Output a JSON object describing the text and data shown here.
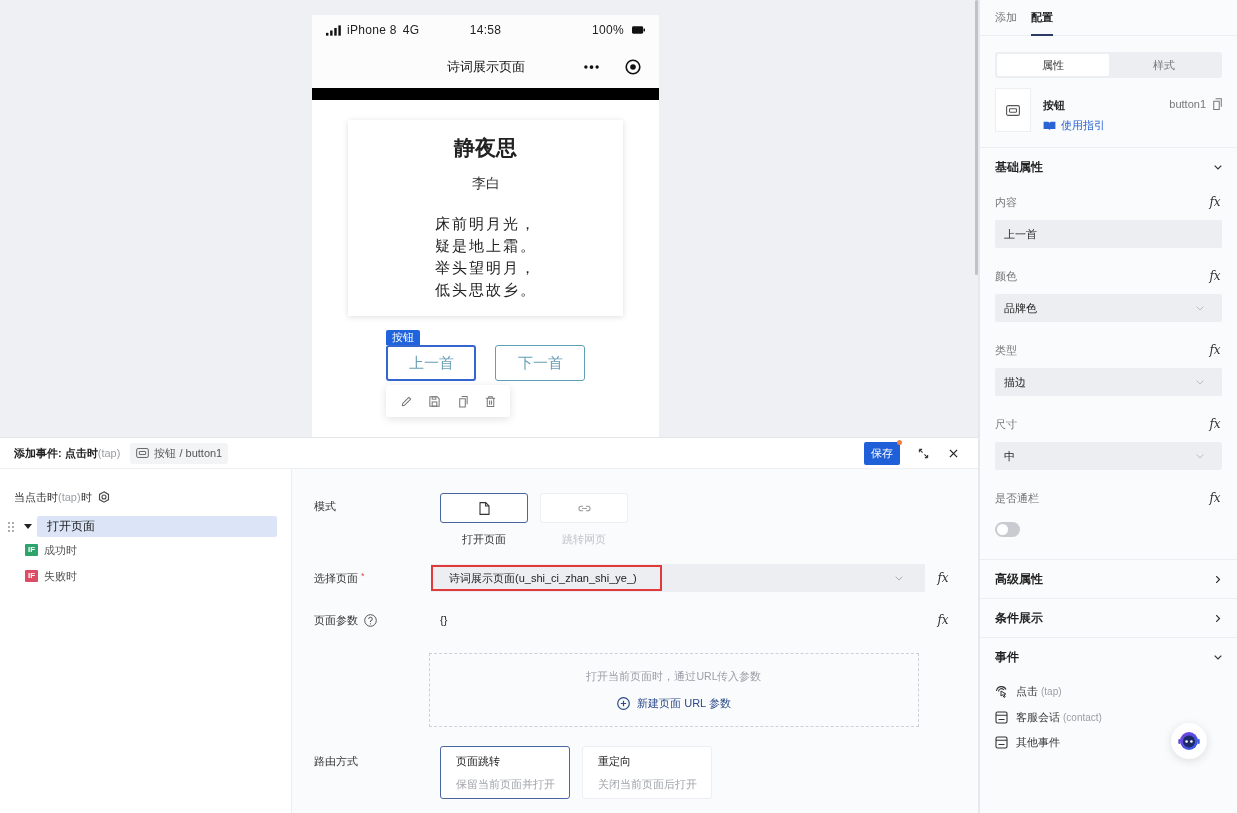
{
  "canvas": {
    "phone": {
      "status_bar": {
        "carrier": "iPhone 8",
        "network": "4G",
        "time": "14:58",
        "battery": "100%"
      },
      "nav_title": "诗词展示页面",
      "poem": {
        "title": "静夜思",
        "author": "李白",
        "lines": [
          "床前明月光，",
          "疑是地上霜。",
          "举头望明月，",
          "低头思故乡。"
        ]
      },
      "selection_tag": "按钮",
      "buttons": [
        {
          "label": "上一首",
          "selected": true
        },
        {
          "label": "下一首",
          "selected": false
        }
      ]
    }
  },
  "event_panel": {
    "title": "添加事件: 点击时",
    "title_hint": "(tap)",
    "target": "按钮 / button1",
    "save": {
      "label": "保存",
      "unsaved": true
    },
    "trigger": {
      "label": "当点击时",
      "hint": "(tap)",
      "suffix": "时"
    },
    "actions": [
      {
        "label": "打开页面",
        "selected": true,
        "expanded": true,
        "children": [
          {
            "badge": "IF",
            "label": "成功时",
            "color": "#2da46c"
          },
          {
            "badge": "IF",
            "label": "失败时",
            "color": "#dc4c64"
          }
        ]
      }
    ],
    "form": {
      "mode": {
        "label": "模式",
        "options": [
          {
            "kind": "page",
            "label": "打开页面",
            "selected": true,
            "disabled": false
          },
          {
            "kind": "link",
            "label": "跳转网页",
            "selected": false,
            "disabled": true
          }
        ]
      },
      "page_select": {
        "label": "选择页面",
        "required_mark": "*",
        "value": "诗词展示页面(u_shi_ci_zhan_shi_ye_)",
        "highlighted": true,
        "fx": "fx"
      },
      "params": {
        "label": "页面参数",
        "value": "{}",
        "fx": "fx",
        "hint": "打开当前页面时，通过URL传入参数",
        "add_link": "新建页面 URL 参数"
      },
      "route": {
        "label": "路由方式",
        "options": [
          {
            "title": "页面跳转",
            "description": "保留当前页面并打开",
            "selected": true
          },
          {
            "title": "重定向",
            "description": "关闭当前页面后打开",
            "selected": false
          }
        ]
      }
    }
  },
  "config_panel": {
    "tabs": [
      {
        "label": "添加",
        "selected": false
      },
      {
        "label": "配置",
        "selected": true
      }
    ],
    "segments": [
      {
        "label": "属性",
        "selected": true
      },
      {
        "label": "样式",
        "selected": false
      }
    ],
    "component": {
      "name": "按钮",
      "guide": "使用指引",
      "id": "button1"
    },
    "sections": [
      {
        "title": "基础属性",
        "expanded": true,
        "fields": [
          {
            "kind": "input",
            "label": "内容",
            "fx": "fx",
            "value": "上一首"
          },
          {
            "kind": "select",
            "label": "颜色",
            "fx": "fx",
            "value": "品牌色"
          },
          {
            "kind": "select",
            "label": "类型",
            "fx": "fx",
            "value": "描边"
          },
          {
            "kind": "select",
            "label": "尺寸",
            "fx": "fx",
            "value": "中"
          },
          {
            "kind": "switch",
            "label": "是否通栏",
            "fx": "fx",
            "on": false
          }
        ]
      },
      {
        "title": "高级属性",
        "expanded": false
      },
      {
        "title": "条件展示",
        "expanded": false
      },
      {
        "title": "事件",
        "expanded": true,
        "events": [
          {
            "kind": "tap",
            "label": "点击",
            "hint": "(tap)"
          },
          {
            "kind": "window",
            "label": "客服会话",
            "hint": "(contact)"
          },
          {
            "kind": "window",
            "label": "其他事件"
          }
        ]
      }
    ]
  }
}
